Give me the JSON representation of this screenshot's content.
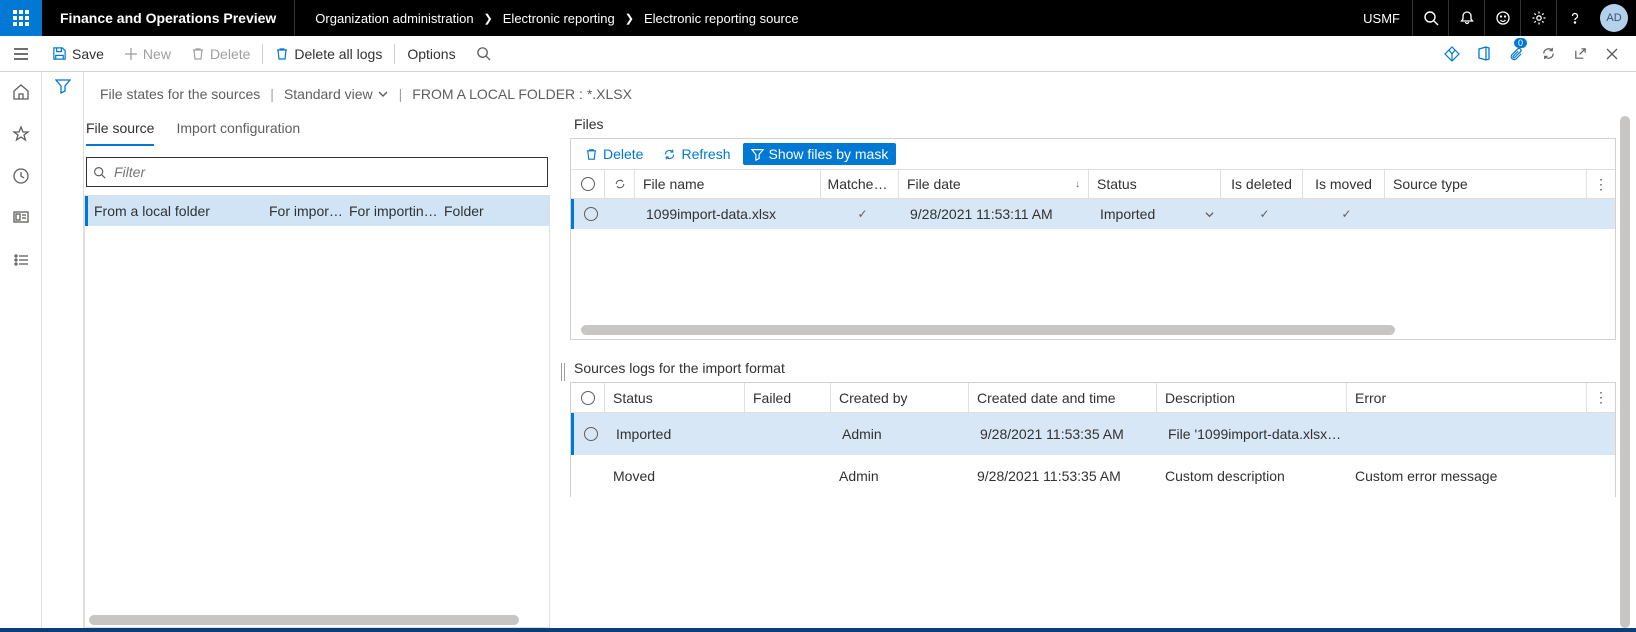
{
  "topbar": {
    "app_title": "Finance and Operations Preview",
    "crumbs": [
      "Organization administration",
      "Electronic reporting",
      "Electronic reporting source"
    ],
    "company": "USMF",
    "avatar": "AD"
  },
  "cmdbar": {
    "save": "Save",
    "new": "New",
    "delete": "Delete",
    "delete_logs": "Delete all logs",
    "options": "Options",
    "attach_badge": "0"
  },
  "heading": {
    "title": "File states for the sources",
    "view": "Standard view",
    "context": "FROM A LOCAL FOLDER : *.XLSX"
  },
  "tabs": {
    "file_source": "File source",
    "import_config": "Import configuration"
  },
  "filter_placeholder": "Filter",
  "sources": [
    {
      "name": "From a local folder",
      "c2": "For impor…",
      "c3": "For importin…",
      "c4": "Folder"
    }
  ],
  "files": {
    "title": "Files",
    "toolbar": {
      "delete": "Delete",
      "refresh": "Refresh",
      "mask": "Show files by mask"
    },
    "headers": {
      "name": "File name",
      "matched": "Matche…",
      "date": "File date",
      "status": "Status",
      "deleted": "Is deleted",
      "moved": "Is moved",
      "srctype": "Source type"
    },
    "rows": [
      {
        "name": "1099import-data.xlsx",
        "matched": true,
        "date": "9/28/2021 11:53:11 AM",
        "status": "Imported",
        "deleted": true,
        "moved": true,
        "srctype": ""
      }
    ]
  },
  "logs": {
    "title": "Sources logs for the import format",
    "headers": {
      "status": "Status",
      "failed": "Failed",
      "by": "Created by",
      "dt": "Created date and time",
      "desc": "Description",
      "err": "Error"
    },
    "rows": [
      {
        "status": "Imported",
        "failed": "",
        "by": "Admin",
        "dt": "9/28/2021 11:53:35 AM",
        "desc": "File '1099import-data.xlsx…",
        "err": "",
        "sel": true
      },
      {
        "status": "Moved",
        "failed": "",
        "by": "Admin",
        "dt": "9/28/2021 11:53:35 AM",
        "desc": "Custom description",
        "err": "Custom error message",
        "sel": false
      }
    ]
  }
}
